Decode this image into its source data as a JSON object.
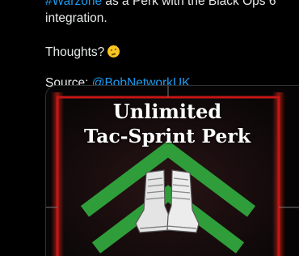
{
  "tweet": {
    "line1_hashtag": "#Warzone",
    "line1_rest": " as a Perk with the Black Ops 6",
    "line2": "integration.",
    "question": "Thoughts?",
    "question_emoji": "thinking-face-emoji",
    "source_label": "Source:",
    "source_mention": "@BobNetworkUK"
  },
  "media": {
    "title_line1": "Unlimited",
    "title_line2": "Tac-Sprint Perk",
    "colors": {
      "frame_red": "#c41616",
      "chevron_green": "#2f9e3a",
      "link_blue": "#1d9bf0"
    },
    "icons": [
      "boots-icon",
      "chevron-up-icon"
    ]
  }
}
